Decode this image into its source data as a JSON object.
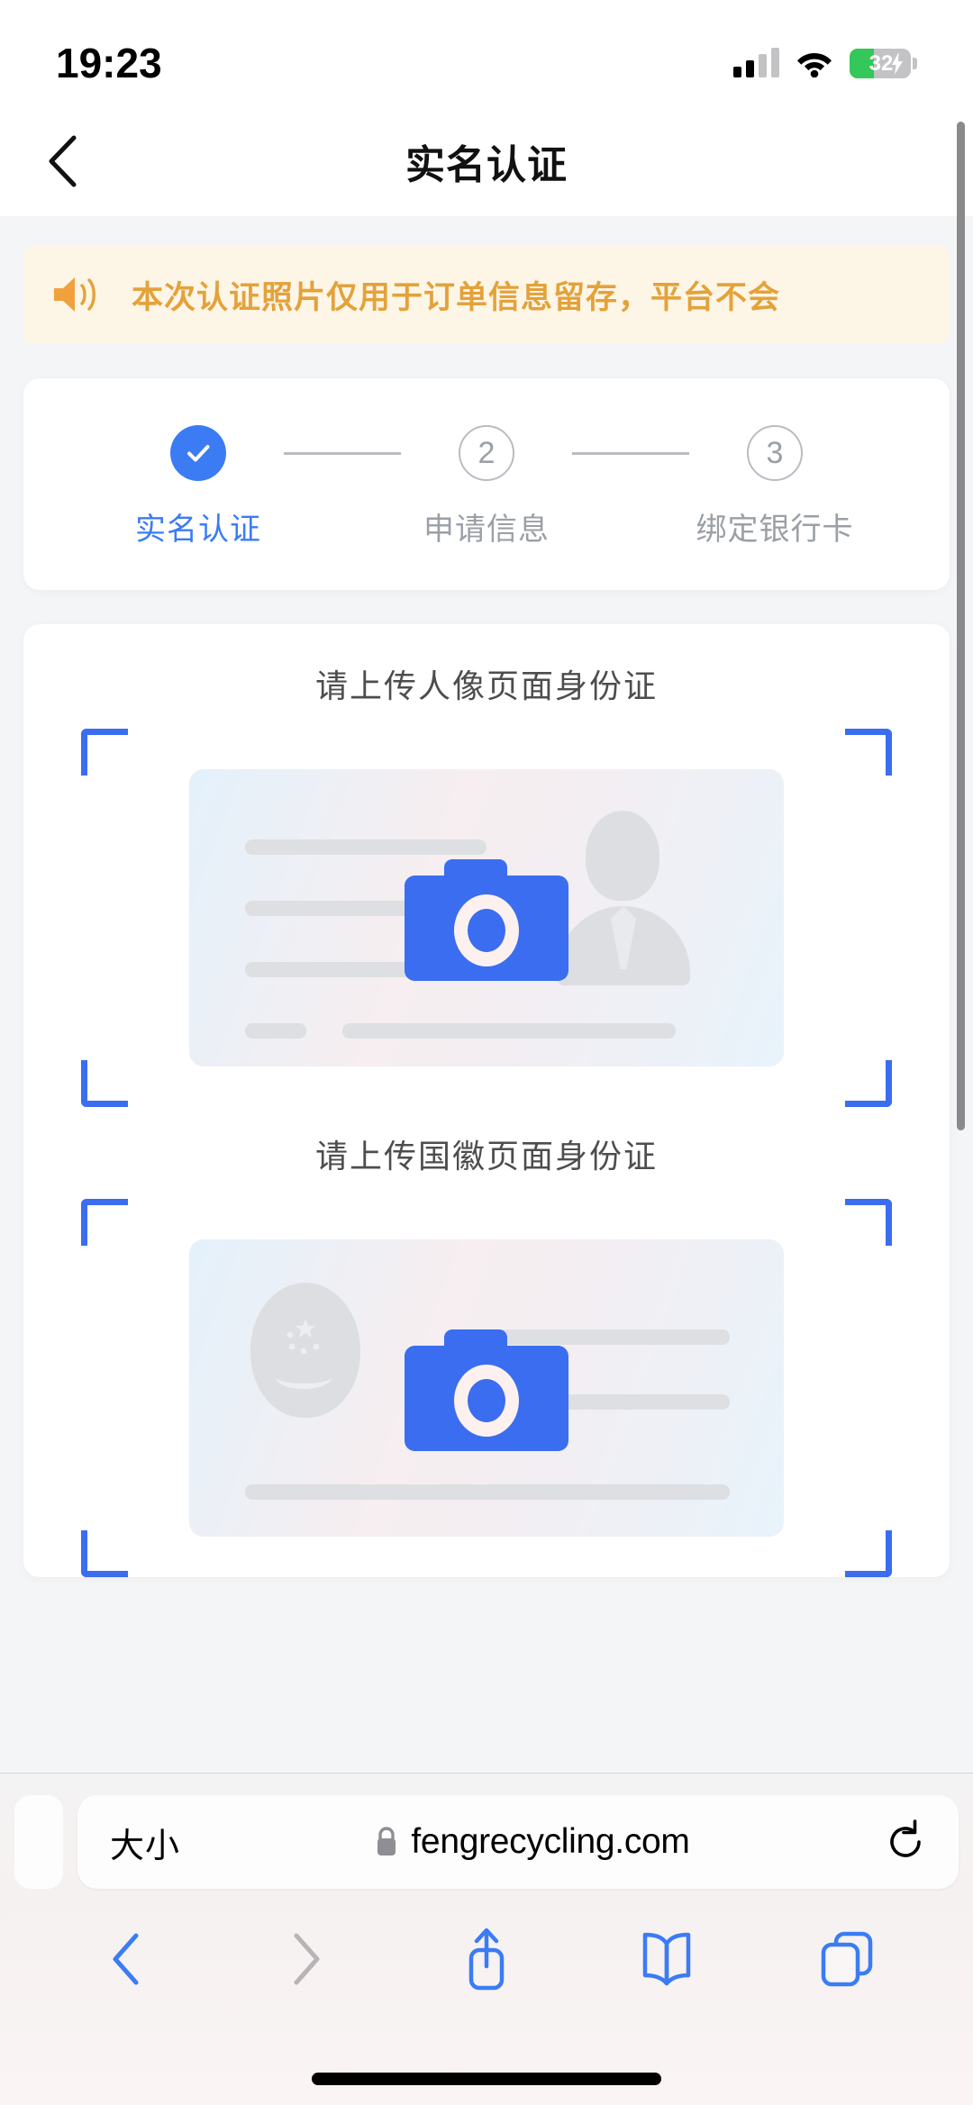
{
  "status_bar": {
    "time": "19:23",
    "signal_icon": "cellular-signal-icon",
    "wifi_icon": "wifi-icon",
    "battery_level": "32",
    "battery_icon": "battery-charging-icon"
  },
  "nav": {
    "back_icon": "chevron-left-icon",
    "title": "实名认证"
  },
  "notice": {
    "icon": "speaker-icon",
    "text": "本次认证照片仅用于订单信息留存，平台不会"
  },
  "stepper": {
    "steps": [
      {
        "marker": "✓",
        "label": "实名认证",
        "state": "done"
      },
      {
        "marker": "2",
        "label": "申请信息",
        "state": "todo"
      },
      {
        "marker": "3",
        "label": "绑定银行卡",
        "state": "todo"
      }
    ]
  },
  "uploads": [
    {
      "title": "请上传人像页面身份证",
      "icon": "camera-icon",
      "name": "id-card-portrait-side"
    },
    {
      "title": "请上传国徽页面身份证",
      "icon": "camera-icon",
      "name": "id-card-emblem-side"
    }
  ],
  "browser": {
    "text_size_label": "大小",
    "lock_icon": "lock-icon",
    "url": "fengrecycling.com",
    "reload_icon": "reload-icon",
    "back_icon": "chevron-left-icon",
    "forward_icon": "chevron-right-icon",
    "share_icon": "share-icon",
    "bookmarks_icon": "book-icon",
    "tabs_icon": "tabs-icon"
  },
  "colors": {
    "accent_blue": "#3b7cf5",
    "notice_orange": "#e3a23a",
    "notice_bg": "#fdf5e6",
    "page_bg": "#f4f5f7",
    "battery_green": "#34c759"
  }
}
